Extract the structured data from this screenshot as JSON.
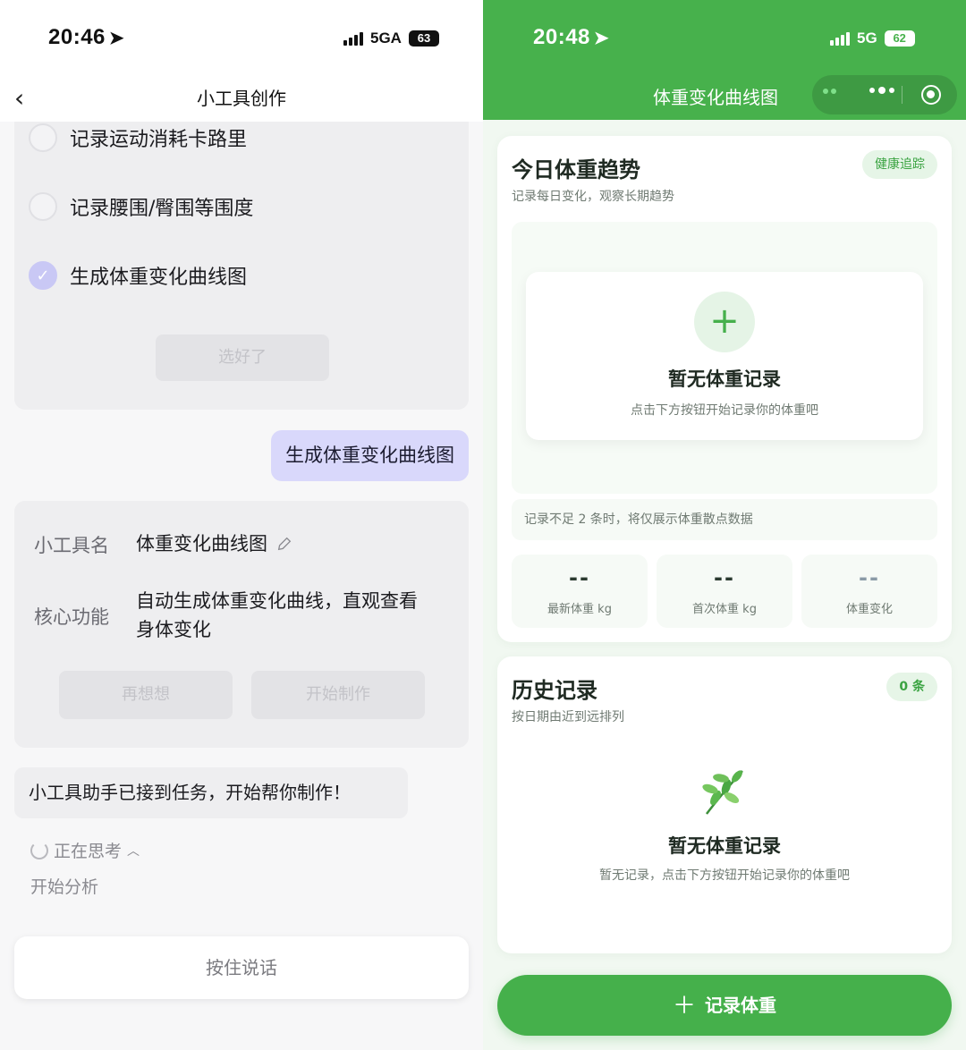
{
  "left": {
    "status": {
      "time": "20:46",
      "network": "5GA",
      "battery": "63"
    },
    "nav": {
      "title": "小工具创作"
    },
    "options": [
      {
        "label": "记录运动消耗卡路里",
        "checked": false
      },
      {
        "label": "记录腰围/臀围等围度",
        "checked": false
      },
      {
        "label": "生成体重变化曲线图",
        "checked": true
      }
    ],
    "chosen_button": "选好了",
    "user_message": "生成体重变化曲线图",
    "info": {
      "name_key": "小工具名",
      "name_value": "体重变化曲线图",
      "func_key": "核心功能",
      "func_value_line1": "自动生成体重变化曲线，直观查看",
      "func_value_line2": "身体变化",
      "rethink_button": "再想想",
      "start_button": "开始制作"
    },
    "assistant_message": "小工具助手已接到任务，开始帮你制作！",
    "thinking": "正在思考",
    "analysis": "开始分析",
    "talk_button": "按住说话"
  },
  "right": {
    "status": {
      "time": "20:48",
      "network": "5G",
      "battery": "62"
    },
    "header": {
      "title": "体重变化曲线图"
    },
    "trend": {
      "title": "今日体重趋势",
      "subtitle": "记录每日变化，观察长期趋势",
      "pill": "健康追踪",
      "empty_title": "暂无体重记录",
      "empty_desc": "点击下方按钮开始记录你的体重吧",
      "note": "记录不足 2 条时，将仅展示体重散点数据",
      "stats": [
        {
          "value": "--",
          "label": "最新体重 kg"
        },
        {
          "value": "--",
          "label": "首次体重 kg"
        },
        {
          "value": "--",
          "label": "体重变化"
        }
      ]
    },
    "history": {
      "title": "历史记录",
      "subtitle": "按日期由近到远排列",
      "pill": "0 条",
      "empty_title": "暂无体重记录",
      "empty_desc": "暂无记录，点击下方按钮开始记录你的体重吧"
    },
    "record_button": "记录体重"
  },
  "colors": {
    "brand_green": "#47b14c",
    "bubble_purple": "#d9d8fb",
    "check_purple": "#c9c8f5"
  }
}
